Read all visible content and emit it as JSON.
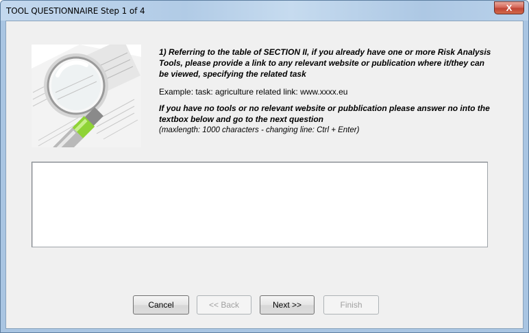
{
  "window": {
    "title": "TOOL QUESTIONNAIRE Step 1 of 4",
    "close_label": "X"
  },
  "question": {
    "main": "1) Referring to the table of SECTION II, if you already have one or more Risk Analysis Tools, please provide a link to any relevant website or publication where it/they can be viewed, specifying the related task",
    "example": "Example: task: agriculture related link: www.xxxx.eu",
    "no_tools": "If you have no tools or no relevant website or pubblication please answer no into the textbox below and go to the next question",
    "hint": "(maxlength: 1000 characters - changing line: Ctrl + Enter)"
  },
  "answer": {
    "value": ""
  },
  "buttons": {
    "cancel": "Cancel",
    "back": "<< Back",
    "next": "Next >>",
    "finish": "Finish"
  },
  "illustration": {
    "icon": "magnifier-over-documents-icon",
    "accent": "#8fd336"
  }
}
